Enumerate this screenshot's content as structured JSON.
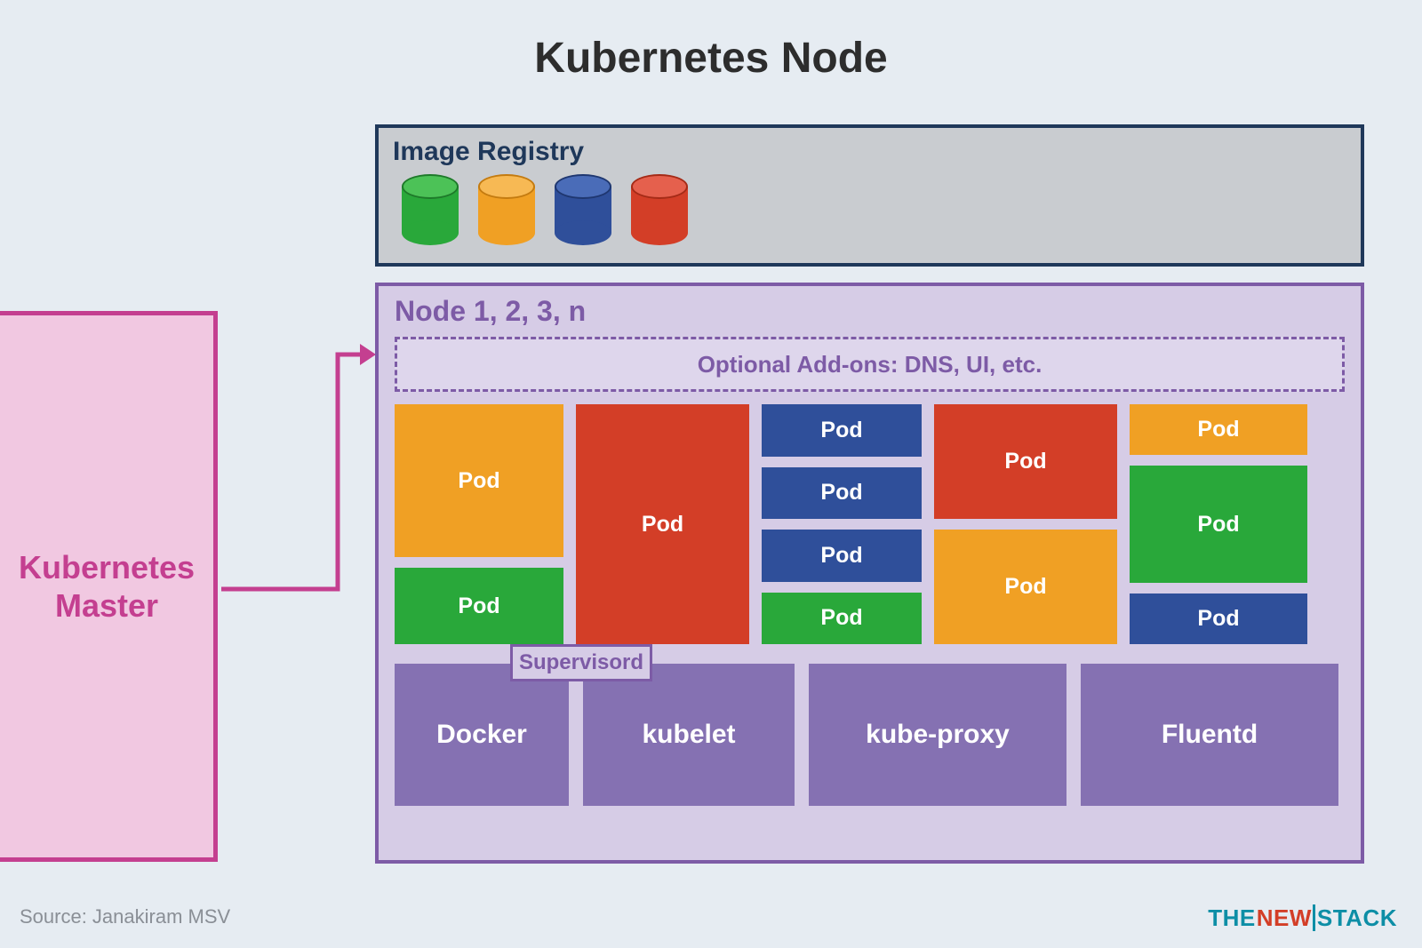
{
  "title": "Kubernetes Node",
  "registry": {
    "title": "Image Registry",
    "cylinders": [
      "green",
      "orange",
      "blue",
      "red"
    ]
  },
  "master": {
    "label_line1": "Kubernetes",
    "label_line2": "Master"
  },
  "node": {
    "title": "Node 1, 2, 3, n",
    "addons": "Optional Add-ons: DNS, UI, etc.",
    "pod_label": "Pod",
    "supervisord": "Supervisord",
    "services": {
      "docker": "Docker",
      "kubelet": "kubelet",
      "kubeproxy": "kube-proxy",
      "fluentd": "Fluentd"
    }
  },
  "source": "Source: Janakiram MSV",
  "brand": {
    "the": "THE",
    "new": "NEW",
    "stack": "STACK"
  }
}
